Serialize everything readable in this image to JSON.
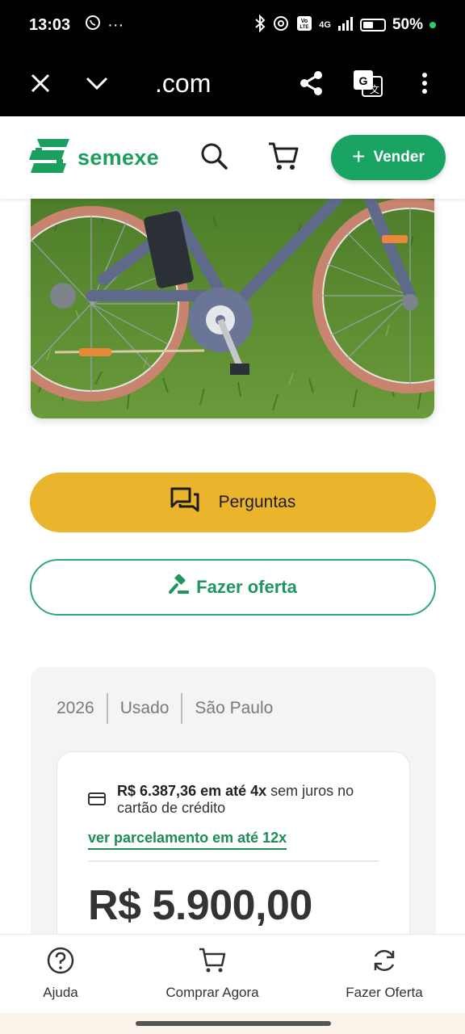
{
  "status_bar": {
    "time": "13:03",
    "extra": "···",
    "network": "4G",
    "battery": "50%",
    "icons": [
      "whatsapp-icon",
      "bluetooth-icon",
      "link-icon",
      "volte-icon",
      "signal-icon",
      "battery-icon"
    ]
  },
  "browser": {
    "url": ".com",
    "icons": [
      "close-icon",
      "chevron-down-icon",
      "share-icon",
      "translate-icon",
      "more-vertical-icon"
    ]
  },
  "header": {
    "logo_text": "semexe",
    "vender_label": "Vender",
    "brand_color": "#1aa463"
  },
  "product": {
    "image_alt": "Bicicleta elétrica azul na grama"
  },
  "actions": {
    "perguntas_label": "Perguntas",
    "fazer_oferta_label": "Fazer oferta",
    "perguntas_color": "#ebb42d"
  },
  "details": {
    "year": "2026",
    "condition": "Usado",
    "location": "São Paulo",
    "installment_bold": "R$ 6.387,36 em até 4x",
    "installment_rest": " sem juros no cartão de crédito",
    "ver_parcelamento": "ver parcelamento em até 12x",
    "price": "R$ 5.900,00"
  },
  "bottom_nav": {
    "items": [
      {
        "label": "Ajuda",
        "icon": "help-icon"
      },
      {
        "label": "Comprar Agora",
        "icon": "cart-icon"
      },
      {
        "label": "Fazer Oferta",
        "icon": "refresh-icon"
      }
    ]
  }
}
